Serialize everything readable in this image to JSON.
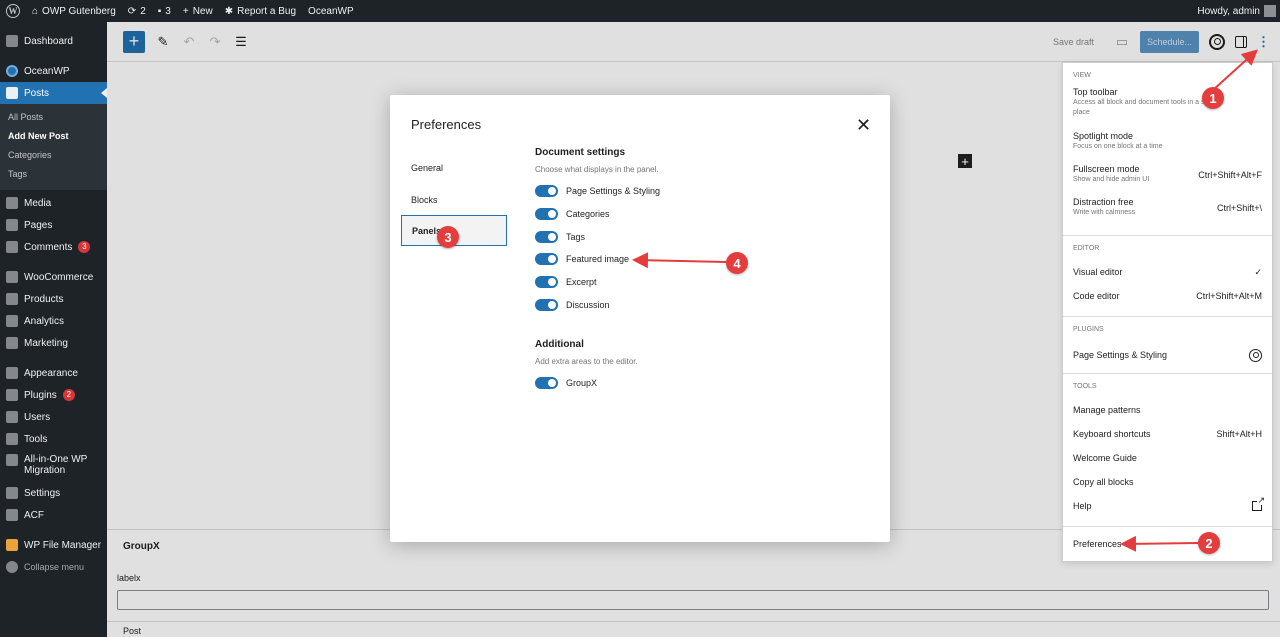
{
  "admin_bar": {
    "site_name": "OWP Gutenberg",
    "updates": "2",
    "comments": "3",
    "new": "New",
    "report_bug": "Report a Bug",
    "oceanwp": "OceanWP",
    "howdy": "Howdy, admin"
  },
  "sidebar": {
    "dashboard": "Dashboard",
    "oceanwp": "OceanWP",
    "posts": "Posts",
    "posts_sub": [
      "All Posts",
      "Add New Post",
      "Categories",
      "Tags"
    ],
    "media": "Media",
    "pages": "Pages",
    "comments": "Comments",
    "comments_badge": "3",
    "woocommerce": "WooCommerce",
    "products": "Products",
    "analytics": "Analytics",
    "marketing": "Marketing",
    "appearance": "Appearance",
    "plugins": "Plugins",
    "plugins_badge": "2",
    "users": "Users",
    "tools": "Tools",
    "migration_line1": "All-in-One WP",
    "migration_line2": "Migration",
    "settings": "Settings",
    "acf": "ACF",
    "file_manager": "WP File Manager",
    "collapse": "Collapse menu"
  },
  "header": {
    "save_draft": "Save draft",
    "schedule": "Schedule..."
  },
  "modal": {
    "title": "Preferences",
    "nav": [
      "General",
      "Blocks",
      "Panels"
    ],
    "document_settings": {
      "title": "Document settings",
      "desc": "Choose what displays in the panel.",
      "toggles": [
        "Page Settings & Styling",
        "Categories",
        "Tags",
        "Featured image",
        "Excerpt",
        "Discussion"
      ]
    },
    "additional": {
      "title": "Additional",
      "desc": "Add extra areas to the editor.",
      "toggles": [
        "GroupX"
      ]
    }
  },
  "menu": {
    "view_head": "View",
    "top_toolbar": "Top toolbar",
    "top_toolbar_desc": "Access all block and document tools in a single place",
    "spotlight": "Spotlight mode",
    "spotlight_desc": "Focus on one block at a time",
    "fullscreen": "Fullscreen mode",
    "fullscreen_desc": "Show and hide admin UI",
    "fullscreen_sc": "Ctrl+Shift+Alt+F",
    "distraction": "Distraction free",
    "distraction_desc": "Write with calmness",
    "distraction_sc": "Ctrl+Shift+\\",
    "editor_head": "Editor",
    "visual_editor": "Visual editor",
    "check": "✓",
    "code_editor": "Code editor",
    "code_editor_sc": "Ctrl+Shift+Alt+M",
    "plugins_head": "Plugins",
    "page_settings": "Page Settings & Styling",
    "tools_head": "Tools",
    "manage_patterns": "Manage patterns",
    "keyboard_shortcuts": "Keyboard shortcuts",
    "keyboard_shortcuts_sc": "Shift+Alt+H",
    "welcome_guide": "Welcome Guide",
    "copy_all": "Copy all blocks",
    "help": "Help",
    "preferences": "Preferences"
  },
  "meta": {
    "groupx_title": "GroupX",
    "label": "labelx",
    "footer": "Post"
  },
  "annotations": [
    "1",
    "2",
    "3",
    "4"
  ],
  "colors": {
    "accent": "#2271b1",
    "annotation": "#e43d3d",
    "admin_dark": "#1d2327"
  }
}
